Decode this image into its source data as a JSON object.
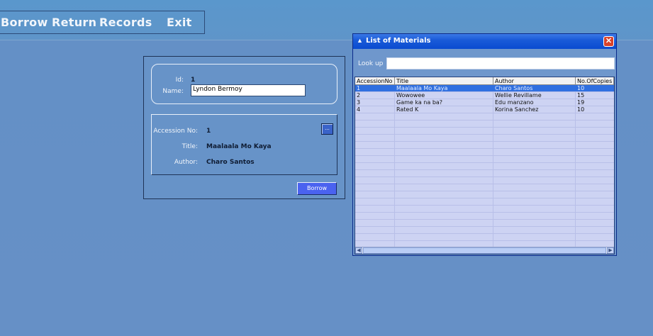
{
  "menu": {
    "borrow": "Borrow",
    "return": "Return",
    "records": "Records",
    "exit": "Exit"
  },
  "form": {
    "id_label": "Id:",
    "id_value": "1",
    "name_label": "Name:",
    "name_value": "Lyndon Bermoy",
    "accession_label": "Accession No:",
    "accession_value": "1",
    "browse_label": "...",
    "title_label": "Title:",
    "title_value": "Maalaala Mo Kaya",
    "author_label": "Author:",
    "author_value": "Charo Santos",
    "borrow_button": "Borrow"
  },
  "list_window": {
    "title": "List of Materials",
    "close_label": "✕",
    "lookup_label": "Look up",
    "lookup_value": "",
    "columns": [
      "AccessionNo",
      "Title",
      "Author",
      "No.OfCopies"
    ],
    "rows": [
      {
        "accession": "1",
        "title": "Maalaala Mo Kaya",
        "author": "Charo Santos",
        "copies": "10",
        "selected": true
      },
      {
        "accession": "2",
        "title": "Wowowee",
        "author": "Wellie Revillame",
        "copies": "15",
        "selected": false
      },
      {
        "accession": "3",
        "title": "Game ka na ba?",
        "author": "Edu manzano",
        "copies": "19",
        "selected": false
      },
      {
        "accession": "4",
        "title": "Rated K",
        "author": "Korina Sanchez",
        "copies": "10",
        "selected": false
      }
    ]
  },
  "colors": {
    "background": "#6690c6",
    "titlebar": "#0a4bd0",
    "selected_row": "#2f6fe0",
    "grid_background": "#cdd3f3",
    "borrow_button": "#4a62f0"
  }
}
